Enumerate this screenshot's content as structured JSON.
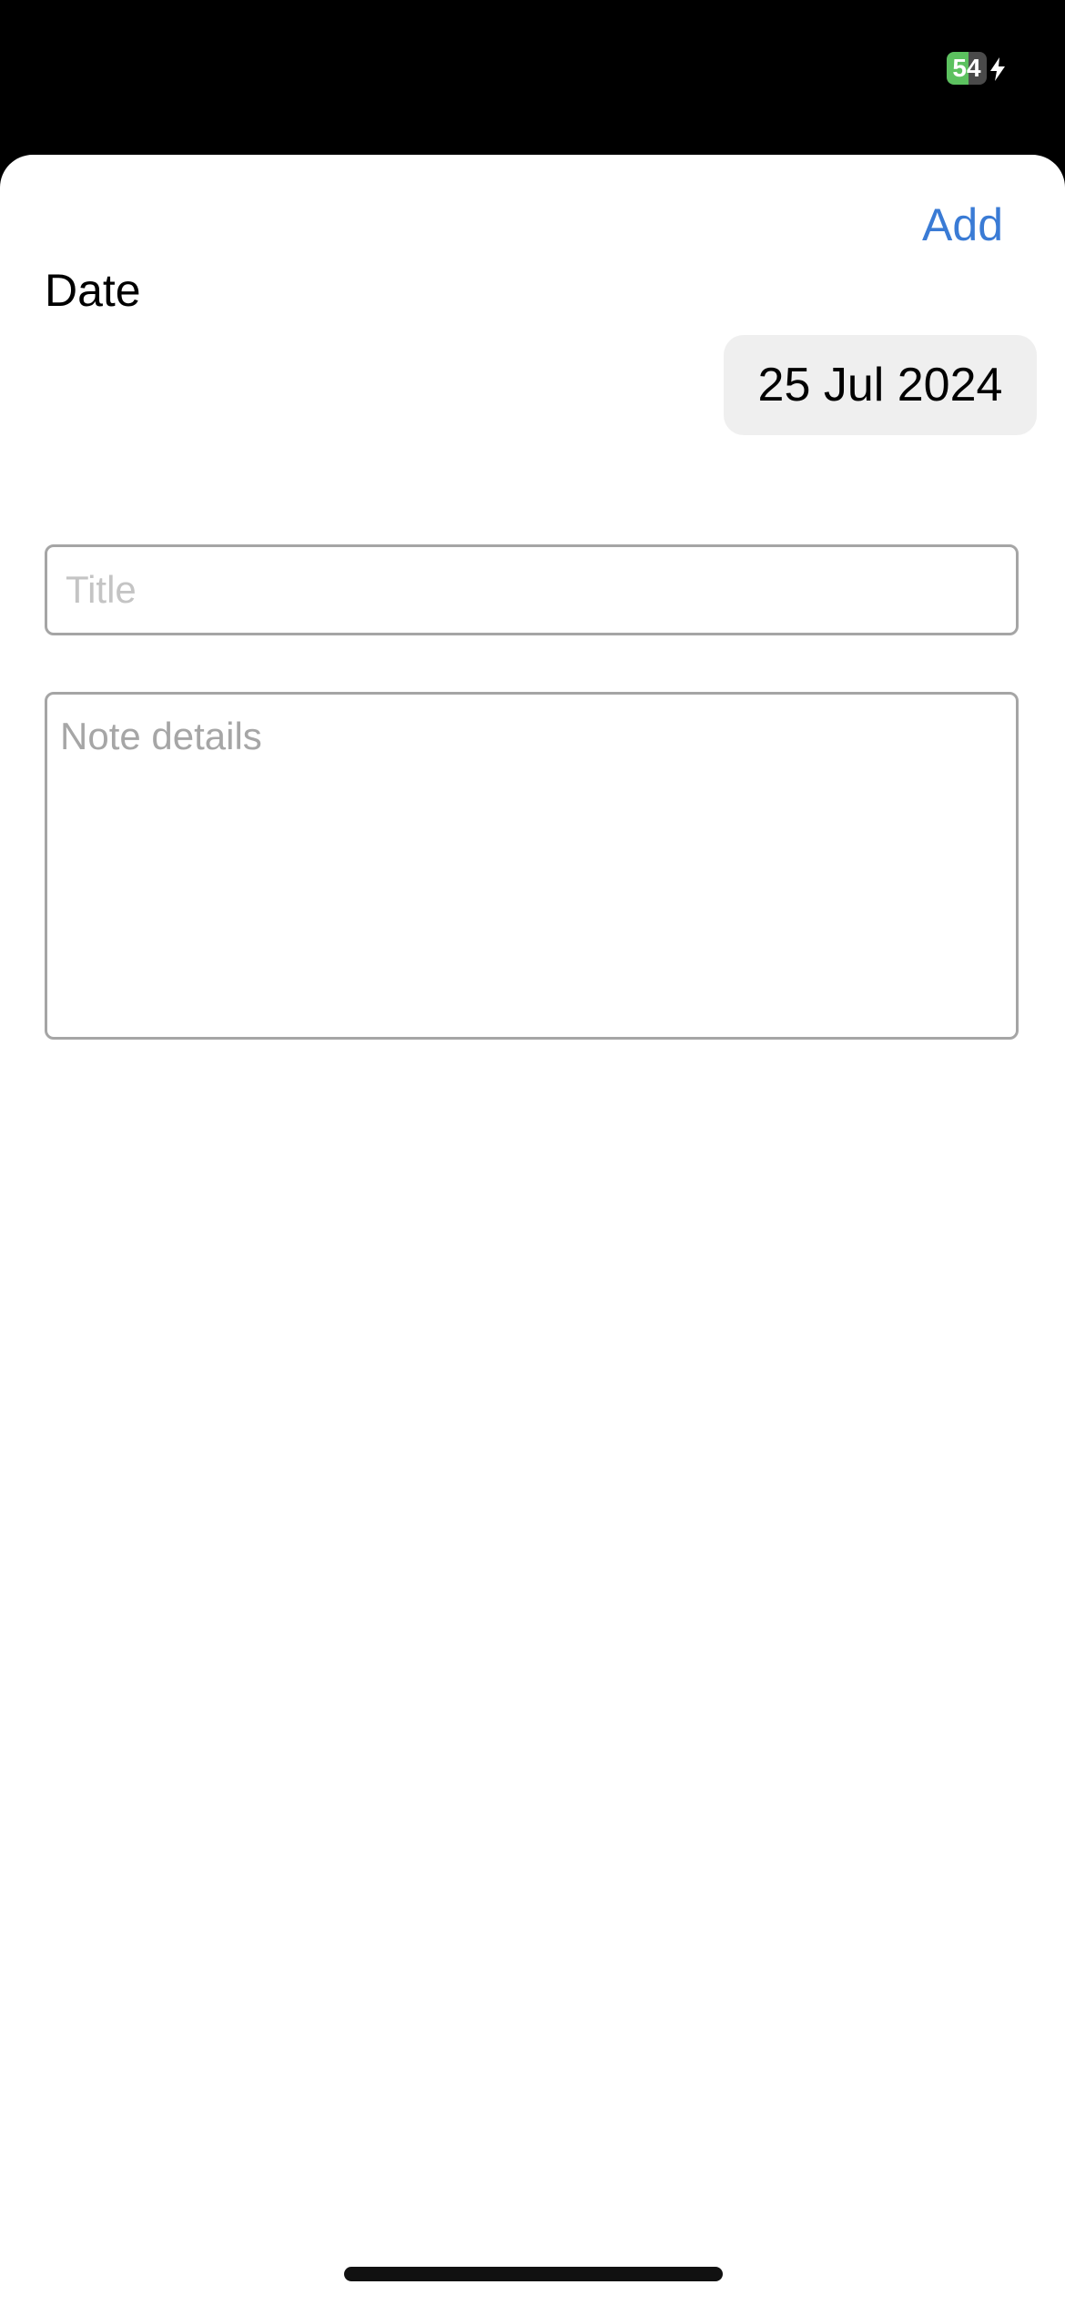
{
  "status_bar": {
    "battery_level": "54",
    "battery_fraction": 0.54,
    "battery_color": "#5cc15f",
    "charging_icon": "bolt-icon"
  },
  "sheet": {
    "add_label": "Add",
    "add_color": "#3a7bd5",
    "date_label": "Date",
    "date_value": "25 Jul 2024",
    "title_placeholder": "Title",
    "note_placeholder": "Note details"
  }
}
